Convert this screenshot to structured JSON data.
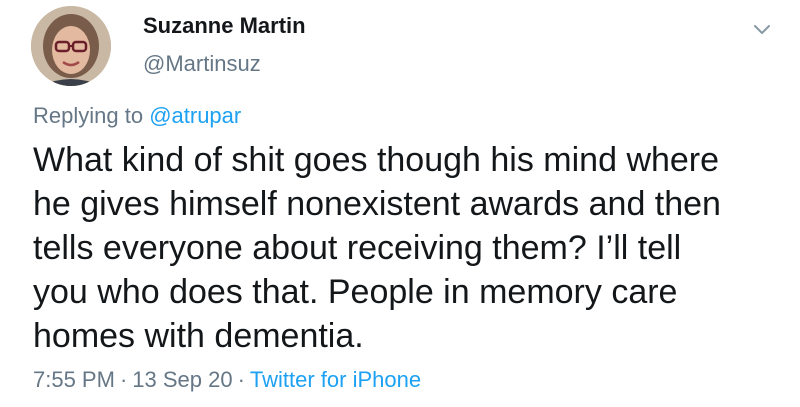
{
  "tweet": {
    "author_name": "Suzanne Martin",
    "author_handle": "@Martinsuz",
    "replying_prefix": "Replying to ",
    "replying_to": "@atrupar",
    "text": "What kind of shit goes though his mind where\nhe gives himself nonexistent awards and then\ntells everyone about receiving them?  I’ll tell\nyou who does that.  People in memory care\nhomes with dementia.",
    "time": "7:55 PM",
    "date": "13 Sep 20",
    "source": "Twitter for iPhone",
    "separator": "·"
  },
  "icons": {
    "avatar": "profile-photo",
    "menu": "chevron-down-icon"
  },
  "colors": {
    "text_primary": "#14171a",
    "text_secondary": "#657786",
    "accent": "#1da1f2"
  }
}
